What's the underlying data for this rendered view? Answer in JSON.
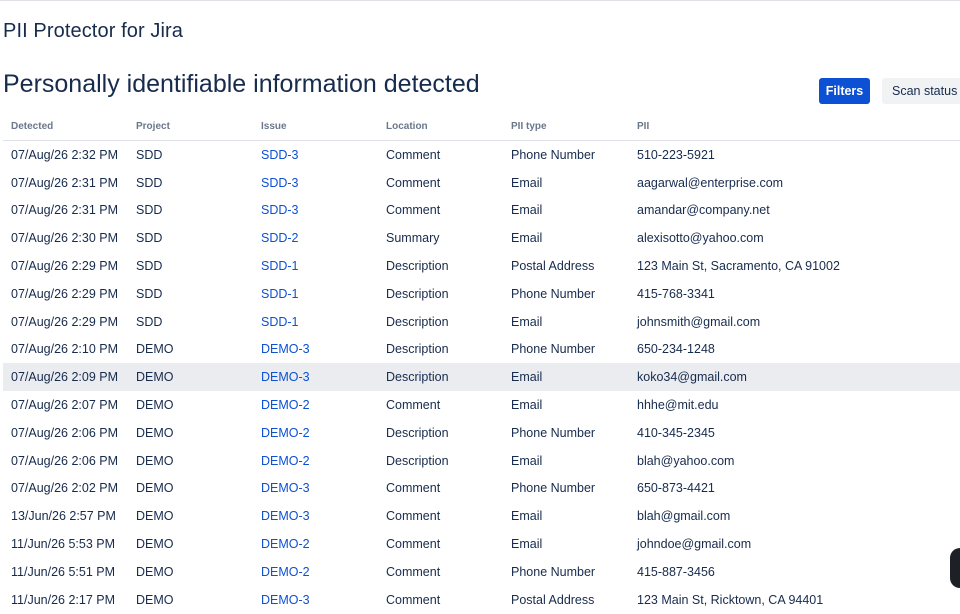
{
  "app": {
    "title": "PII Protector for Jira"
  },
  "page": {
    "title": "Personally identifiable information detected"
  },
  "toolbar": {
    "filters_label": "Filters",
    "scan_status_label": "Scan status"
  },
  "table": {
    "columns": {
      "detected": "Detected",
      "project": "Project",
      "issue": "Issue",
      "location": "Location",
      "pii_type": "PII type",
      "pii": "PII"
    },
    "rows": [
      {
        "detected": "07/Aug/26 2:32 PM",
        "project": "SDD",
        "issue": "SDD-3",
        "location": "Comment",
        "pii_type": "Phone Number",
        "pii": "510-223-5921"
      },
      {
        "detected": "07/Aug/26 2:31 PM",
        "project": "SDD",
        "issue": "SDD-3",
        "location": "Comment",
        "pii_type": "Email",
        "pii": "aagarwal@enterprise.com"
      },
      {
        "detected": "07/Aug/26 2:31 PM",
        "project": "SDD",
        "issue": "SDD-3",
        "location": "Comment",
        "pii_type": "Email",
        "pii": "amandar@company.net"
      },
      {
        "detected": "07/Aug/26 2:30 PM",
        "project": "SDD",
        "issue": "SDD-2",
        "location": "Summary",
        "pii_type": "Email",
        "pii": "alexisotto@yahoo.com"
      },
      {
        "detected": "07/Aug/26 2:29 PM",
        "project": "SDD",
        "issue": "SDD-1",
        "location": "Description",
        "pii_type": "Postal Address",
        "pii": "123 Main St, Sacramento, CA 91002"
      },
      {
        "detected": "07/Aug/26 2:29 PM",
        "project": "SDD",
        "issue": "SDD-1",
        "location": "Description",
        "pii_type": "Phone Number",
        "pii": "415-768-3341"
      },
      {
        "detected": "07/Aug/26 2:29 PM",
        "project": "SDD",
        "issue": "SDD-1",
        "location": "Description",
        "pii_type": "Email",
        "pii": "johnsmith@gmail.com"
      },
      {
        "detected": "07/Aug/26 2:10 PM",
        "project": "DEMO",
        "issue": "DEMO-3",
        "location": "Description",
        "pii_type": "Phone Number",
        "pii": "650-234-1248"
      },
      {
        "detected": "07/Aug/26 2:09 PM",
        "project": "DEMO",
        "issue": "DEMO-3",
        "location": "Description",
        "pii_type": "Email",
        "pii": "koko34@gmail.com",
        "highlighted": true
      },
      {
        "detected": "07/Aug/26 2:07 PM",
        "project": "DEMO",
        "issue": "DEMO-2",
        "location": "Comment",
        "pii_type": "Email",
        "pii": "hhhe@mit.edu"
      },
      {
        "detected": "07/Aug/26 2:06 PM",
        "project": "DEMO",
        "issue": "DEMO-2",
        "location": "Description",
        "pii_type": "Phone Number",
        "pii": "410-345-2345"
      },
      {
        "detected": "07/Aug/26 2:06 PM",
        "project": "DEMO",
        "issue": "DEMO-2",
        "location": "Description",
        "pii_type": "Email",
        "pii": "blah@yahoo.com"
      },
      {
        "detected": "07/Aug/26 2:02 PM",
        "project": "DEMO",
        "issue": "DEMO-3",
        "location": "Comment",
        "pii_type": "Phone Number",
        "pii": "650-873-4421"
      },
      {
        "detected": "13/Jun/26 2:57 PM",
        "project": "DEMO",
        "issue": "DEMO-3",
        "location": "Comment",
        "pii_type": "Email",
        "pii": "blah@gmail.com"
      },
      {
        "detected": "11/Jun/26 5:53 PM",
        "project": "DEMO",
        "issue": "DEMO-2",
        "location": "Comment",
        "pii_type": "Email",
        "pii": "johndoe@gmail.com"
      },
      {
        "detected": "11/Jun/26 5:51 PM",
        "project": "DEMO",
        "issue": "DEMO-2",
        "location": "Comment",
        "pii_type": "Phone Number",
        "pii": "415-887-3456"
      },
      {
        "detected": "11/Jun/26 2:17 PM",
        "project": "DEMO",
        "issue": "DEMO-3",
        "location": "Comment",
        "pii_type": "Postal Address",
        "pii": "123 Main St, Ricktown, CA 94401"
      }
    ]
  },
  "colors": {
    "primary": "#0c50d3",
    "text": "#172b4d",
    "header_text": "#6b778c",
    "row_highlight": "#ebecf0"
  }
}
